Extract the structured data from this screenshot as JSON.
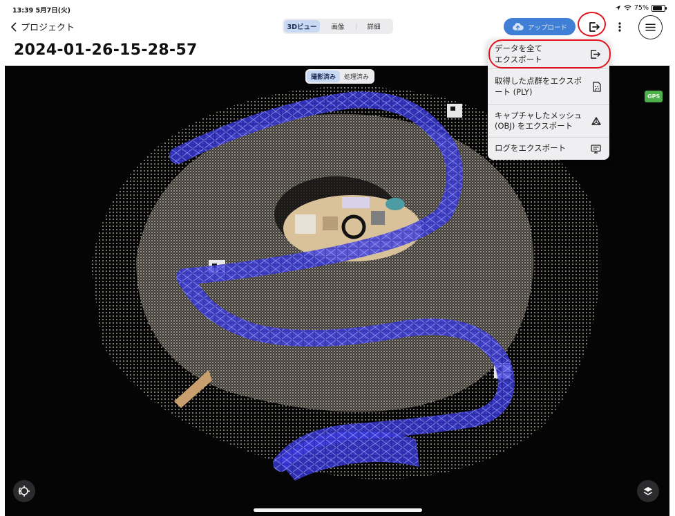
{
  "status": {
    "time": "13:39 5月7日(火)",
    "battery": "75%"
  },
  "nav": {
    "back_label": "プロジェクト",
    "tabs": [
      "3Dビュー",
      "画像",
      "詳細"
    ],
    "upload_label": "アップロード"
  },
  "page": {
    "title": "2024-01-26-15-28-57"
  },
  "viewer": {
    "toggle": [
      "撮影済み",
      "処理済み"
    ],
    "gps_badge": "GPS"
  },
  "export_menu": {
    "items": [
      {
        "label": "データを全て\nエクスポート",
        "icon": "export-icon"
      },
      {
        "label": "取得した点群をエクスポ\nート (PLY)",
        "icon": "point-cloud-file-icon"
      },
      {
        "label": "キャプチャしたメッシュ\n(OBJ) をエクスポート",
        "icon": "mesh-icon"
      },
      {
        "label": "ログをエクスポート",
        "icon": "log-monitor-icon"
      }
    ]
  },
  "colors": {
    "accent": "#3f7fd6",
    "highlight_ring": "#e0141e",
    "gps": "#4db04a",
    "trajectory": "#3a3ad8"
  }
}
